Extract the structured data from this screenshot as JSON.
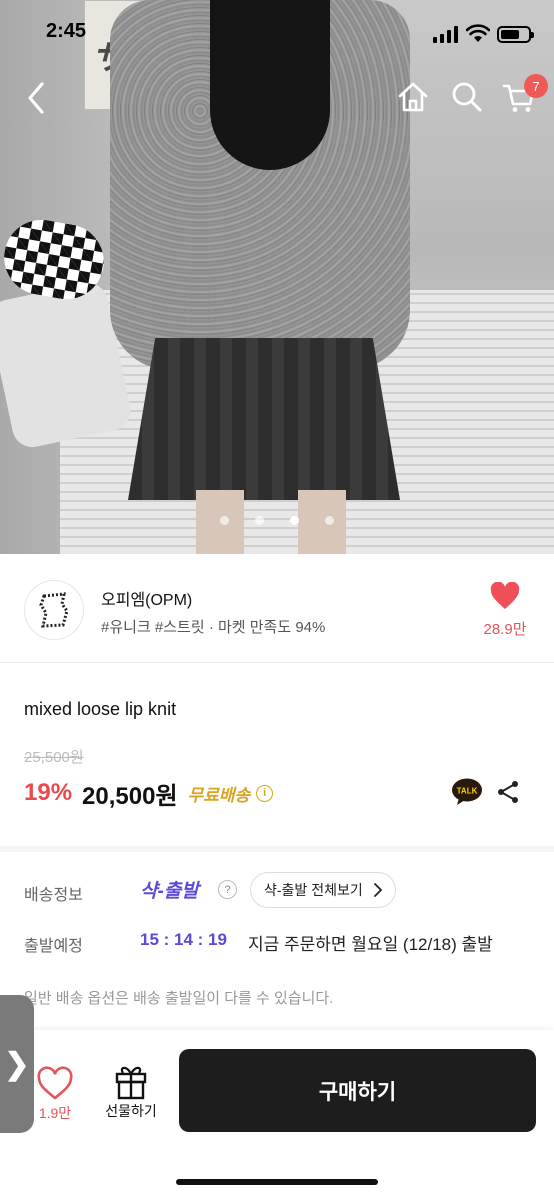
{
  "status_bar": {
    "time": "2:45"
  },
  "photo": {
    "poster_text": "サプ",
    "slide_count": 4,
    "active_slide": 3
  },
  "nav": {
    "cart_count": "7"
  },
  "shop": {
    "name": "오피엠(OPM)",
    "tags": "#유니크 #스트릿 · 마켓 만족도 94%",
    "likes": "28.9만"
  },
  "product": {
    "title": "mixed loose lip knit",
    "original_price": "25,500원",
    "discount": "19%",
    "price": "20,500원",
    "free_shipping": "무료배송",
    "talk_label": "TALK"
  },
  "shipping": {
    "info_label": "배송정보",
    "fast_label": "샥-출발",
    "help_mark": "?",
    "view_all": "샥-출발 전체보기",
    "depart_label": "출발예정",
    "countdown": "15 : 14 : 19",
    "depart_text": "지금 주문하면 월요일 (12/18) 출발",
    "note": "일반 배송 옵션은 배송 출발일이 다를 수 있습니다."
  },
  "bottom_bar": {
    "favorites": "1.9만",
    "gift_label": "선물하기",
    "buy_label": "구매하기",
    "side_tab": "❯"
  },
  "colors": {
    "accent_red": "#e84a4f",
    "shipping_purple": "#5b4bd8",
    "free_ship_gold": "#d9a520",
    "buy_button": "#1d1d1d"
  }
}
